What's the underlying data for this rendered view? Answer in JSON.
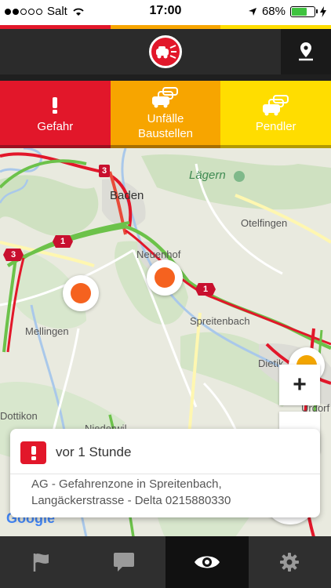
{
  "status_bar": {
    "carrier": "Salt",
    "time": "17:00",
    "battery": "68%",
    "signal_dots_filled": 2,
    "signal_dots_total": 5
  },
  "colors": {
    "danger": "#e2172a",
    "accident": "#f7a500",
    "commuter": "#ffdd00",
    "header": "#2b2b2b"
  },
  "header": {
    "logo_icon": "car-crash-logo-icon",
    "location_icon": "map-pin-icon"
  },
  "categories": [
    {
      "label": "Gefahr",
      "icon": "exclamation-icon"
    },
    {
      "label": "Unfälle\nBaustellen",
      "icon": "cars-collision-icon"
    },
    {
      "label": "Pendler",
      "icon": "cars-queue-icon"
    }
  ],
  "map": {
    "places": {
      "baden": "Baden",
      "laegern": "Lägern",
      "otelfingen": "Otelfingen",
      "neuenhof": "Neuenhof",
      "spreitenbach": "Spreitenbach",
      "mellingen": "Mellingen",
      "dietikon": "Dietik",
      "urdorf": "Urdorf",
      "dottikon": "Dottikon",
      "niederwil": "Niederwil"
    },
    "shields": {
      "a3_north": "3",
      "a3_west": "3",
      "a1_west": "1",
      "a1_east": "1"
    },
    "zoom_in": "+",
    "attribution": "Google"
  },
  "info_card": {
    "time_ago": "vor 1 Stunde",
    "description_line1": "AG - Gefahrenzone in Spreitenbach,",
    "description_line2": "Langäckerstrasse - Delta 0215880330"
  },
  "tab_bar": [
    {
      "name": "flag-icon",
      "active": false
    },
    {
      "name": "chat-icon",
      "active": false
    },
    {
      "name": "eye-icon",
      "active": true
    },
    {
      "name": "gear-icon",
      "active": false
    }
  ]
}
